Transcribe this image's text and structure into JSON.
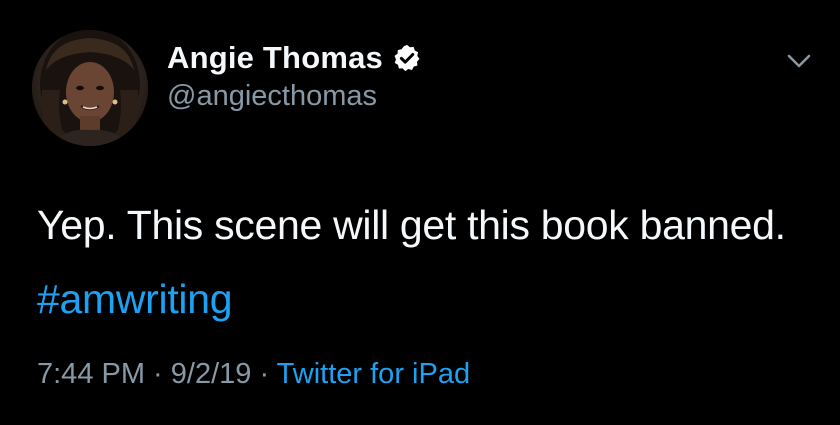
{
  "colors": {
    "background": "#000000",
    "primary_text": "#f5f8fa",
    "secondary_text": "#8899a6",
    "link": "#1da1f2"
  },
  "author": {
    "display_name": "Angie Thomas",
    "handle": "@angiecthomas",
    "verified_icon": "verified-badge-icon",
    "avatar_icon": "avatar"
  },
  "menu": {
    "icon": "chevron-down-icon"
  },
  "tweet": {
    "text_before": "Yep. This scene will get this book banned. ",
    "hashtag": "#amwriting"
  },
  "meta": {
    "time": "7:44 PM",
    "sep1": " · ",
    "date": "9/2/19",
    "sep2": " · ",
    "source": "Twitter for iPad"
  }
}
